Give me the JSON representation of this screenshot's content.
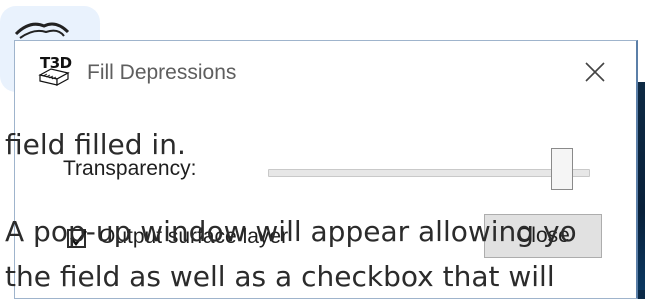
{
  "dialog": {
    "app_icon_text": "T3D",
    "title": "Fill Depressions",
    "transparency_label": "Transparency:",
    "transparency_level_fraction": 0.95,
    "output_surface_label": "Output surface layer",
    "output_surface_checked": true,
    "close_button_label": "Close"
  },
  "document": {
    "lines": [
      "field filled in.",
      "A pop-up window will appear allowing yo",
      "the field as well as a checkbox that will"
    ]
  },
  "colors": {
    "icon_tile": "#e9f2fd",
    "dialog_border": "#9fb4cc",
    "button_face": "#e1e1e1",
    "desktop_dark": "#0e2a44"
  }
}
